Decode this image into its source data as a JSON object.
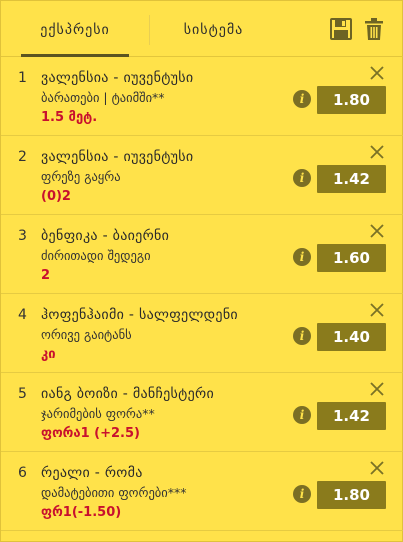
{
  "tabs": {
    "express": "ექსპრესი",
    "system": "სისტემა"
  },
  "icons": {
    "save": "save-icon",
    "trash": "trash-icon",
    "close": "close-icon",
    "info": "info-icon"
  },
  "colors": {
    "background": "#ffe24a",
    "odd_button": "#8a7b1c",
    "pick": "#c8102e"
  },
  "bets": [
    {
      "num": "1",
      "match": "ვალენსია - იუვენტუსი",
      "market": "ბარათები | ტაიმში**",
      "pick": "1.5 მეტ.",
      "odd": "1.80"
    },
    {
      "num": "2",
      "match": "ვალენსია - იუვენტუსი",
      "market": "ფრეზე გაყრა",
      "pick": "(0)2",
      "odd": "1.42"
    },
    {
      "num": "3",
      "match": "ბენფიკა - ბაიერნი",
      "market": "ძირითადი შედეგი",
      "pick": "2",
      "odd": "1.60"
    },
    {
      "num": "4",
      "match": "ჰოფენჰაიმი - სალფელდენი",
      "market": "ორივე გაიტანს",
      "pick": "კი",
      "odd": "1.40"
    },
    {
      "num": "5",
      "match": "იანგ ბოიზი - მანჩესტერი",
      "market": "ჯარიმების ფორა**",
      "pick": "ფორა1 (+2.5)",
      "odd": "1.42"
    },
    {
      "num": "6",
      "match": "რეალი - რომა",
      "market": "დამატებითი ფორები***",
      "pick": "ფრ1(-1.50)",
      "odd": "1.80"
    }
  ]
}
